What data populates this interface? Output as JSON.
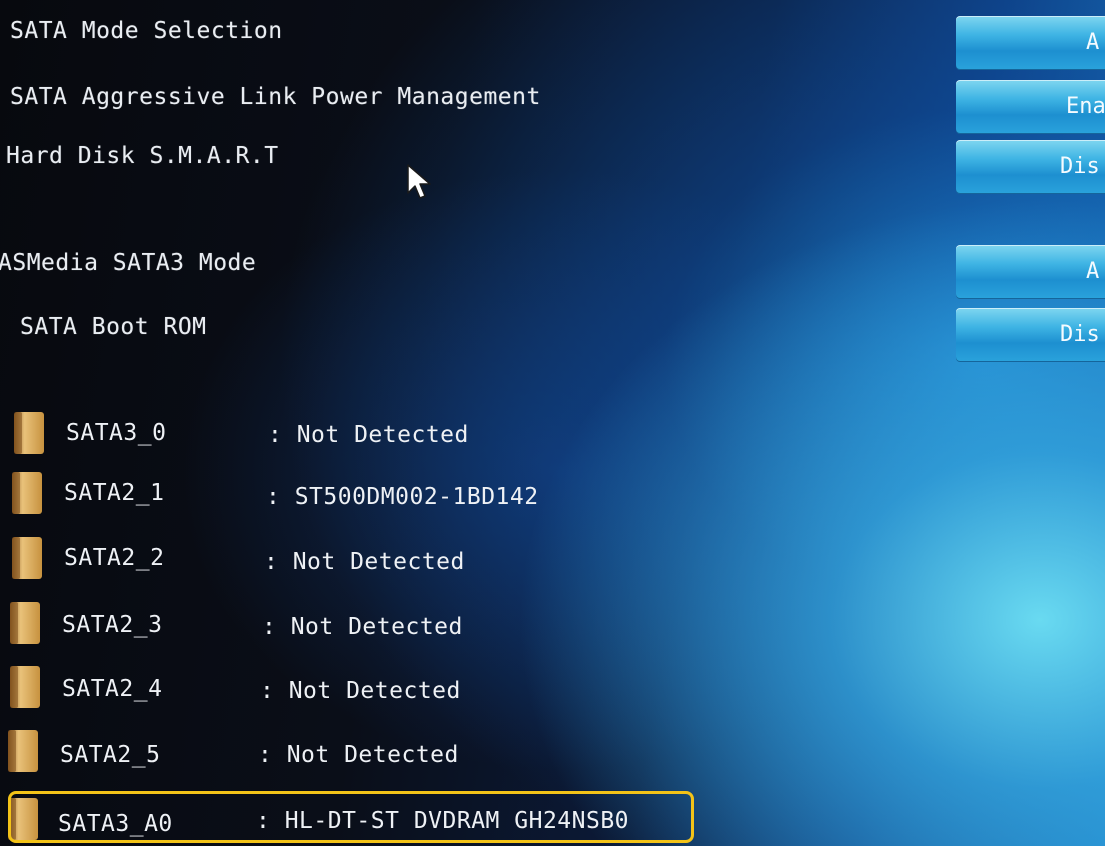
{
  "settings": [
    {
      "label": "SATA Mode Selection",
      "value": "A"
    },
    {
      "label": "SATA Aggressive Link Power Management",
      "value": "Ena"
    },
    {
      "label": "Hard Disk S.M.A.R.T",
      "value": "Dis"
    },
    {
      "label": "ASMedia SATA3 Mode",
      "value": "A"
    },
    {
      "label": "SATA Boot ROM",
      "value": "Dis"
    }
  ],
  "ports": [
    {
      "name": "SATA3_0",
      "value": ": Not Detected"
    },
    {
      "name": "SATA2_1",
      "value": ": ST500DM002-1BD142"
    },
    {
      "name": "SATA2_2",
      "value": ": Not Detected"
    },
    {
      "name": "SATA2_3",
      "value": ": Not Detected"
    },
    {
      "name": "SATA2_4",
      "value": ": Not Detected"
    },
    {
      "name": "SATA2_5",
      "value": ": Not Detected"
    },
    {
      "name": "SATA3_A0",
      "value": ": HL-DT-ST DVDRAM GH24NSB0"
    }
  ],
  "colors": {
    "highlight_border": "#f3c318",
    "option_button": "#2aa3dc",
    "folder": "#e0b56a"
  },
  "icons": {
    "folder": "folder-icon",
    "cursor": "mouse-pointer-icon"
  }
}
